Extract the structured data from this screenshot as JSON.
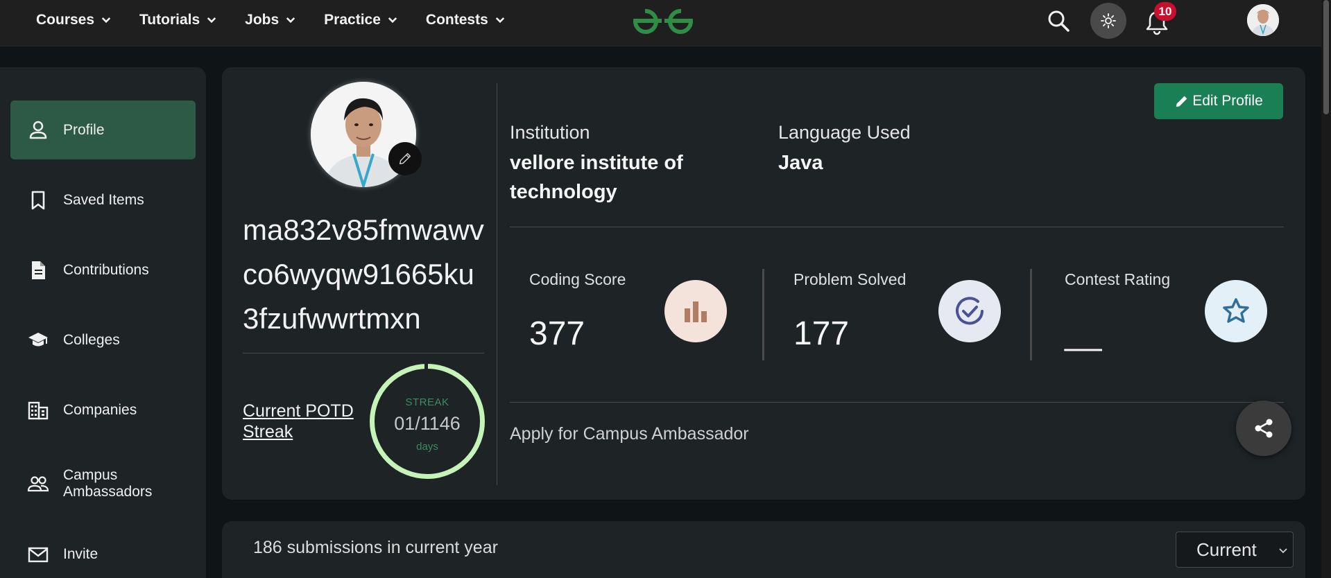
{
  "nav": {
    "menu": [
      {
        "label": "Courses"
      },
      {
        "label": "Tutorials"
      },
      {
        "label": "Jobs"
      },
      {
        "label": "Practice"
      },
      {
        "label": "Contests"
      }
    ],
    "notification_count": "10",
    "brand_color": "#2f8d46"
  },
  "sidebar": {
    "items": [
      {
        "label": "Profile",
        "icon": "person-icon",
        "active": true
      },
      {
        "label": "Saved Items",
        "icon": "bookmark-icon"
      },
      {
        "label": "Contributions",
        "icon": "document-icon"
      },
      {
        "label": "Colleges",
        "icon": "graduation-cap-icon"
      },
      {
        "label": "Companies",
        "icon": "building-icon"
      },
      {
        "label": "Campus Ambassadors",
        "icon": "people-icon"
      },
      {
        "label": "Invite",
        "icon": "mail-icon"
      }
    ]
  },
  "profile": {
    "username": "ma832v85fmwawvco6wyqw91665ku3fzufwwrtmxn",
    "potd_label": "Current POTD Streak",
    "streak_title": "STREAK",
    "streak_value": "01/1146",
    "streak_unit": "days",
    "edit_label": "Edit Profile",
    "institution_label": "Institution",
    "institution_value": "vellore institute of technology",
    "language_label": "Language Used",
    "language_value": "Java",
    "stats": [
      {
        "label": "Coding Score",
        "value": "377",
        "icon": "bar-chart-icon"
      },
      {
        "label": "Problem Solved",
        "value": "177",
        "icon": "check-circle-icon"
      },
      {
        "label": "Contest Rating",
        "value": "__",
        "icon": "star-icon"
      }
    ],
    "ambassador_label": "Apply for Campus Ambassador"
  },
  "submissions": {
    "text": "186 submissions in current year",
    "year_select": "Current"
  }
}
